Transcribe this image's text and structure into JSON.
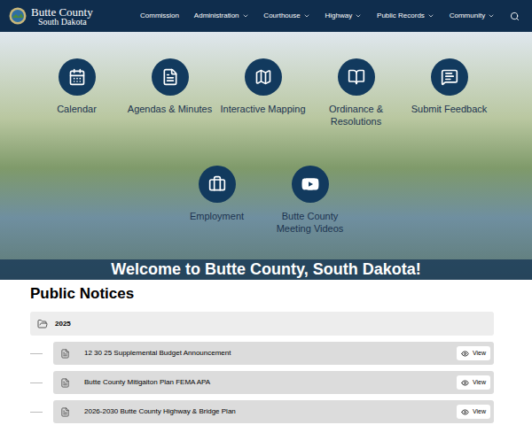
{
  "header": {
    "logo_title": "Butte County",
    "logo_subtitle": "South Dakota",
    "nav": [
      {
        "label": "Commission",
        "has_menu": false
      },
      {
        "label": "Administration",
        "has_menu": true
      },
      {
        "label": "Courthouse",
        "has_menu": true
      },
      {
        "label": "Highway",
        "has_menu": true
      },
      {
        "label": "Public Records",
        "has_menu": true
      },
      {
        "label": "Community",
        "has_menu": true
      }
    ]
  },
  "hero": {
    "tiles": [
      {
        "label": "Calendar"
      },
      {
        "label": "Agendas & Minutes"
      },
      {
        "label": "Interactive Mapping"
      },
      {
        "label": "Ordinance & Resolutions"
      },
      {
        "label": "Submit Feedback"
      },
      {
        "label": "Employment"
      },
      {
        "label": "Butte County Meeting Videos"
      }
    ],
    "banner": "Welcome to Butte County, South Dakota!"
  },
  "notices": {
    "title": "Public Notices",
    "folders": [
      {
        "label": "2025",
        "expanded": true,
        "items": [
          {
            "title": "12 30 25 Supplemental Budget Announcement",
            "action": "View"
          },
          {
            "title": "Butte County Mitigaiton Plan FEMA APA",
            "action": "View"
          },
          {
            "title": "2026-2030 Butte County Highway & Bridge Plan",
            "action": "View"
          }
        ]
      }
    ]
  }
}
